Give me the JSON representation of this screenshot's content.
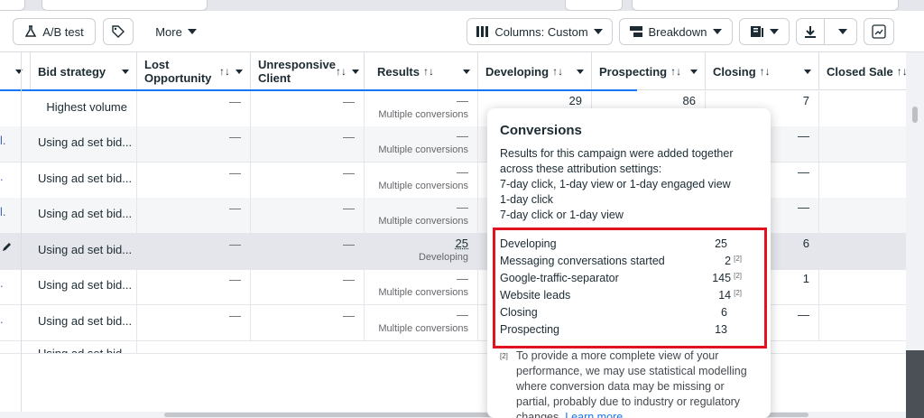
{
  "toolbar": {
    "ab_test_label": "A/B test",
    "more_label": "More",
    "columns_label": "Columns: Custom",
    "breakdown_label": "Breakdown"
  },
  "columns": {
    "bid_strategy": "Bid strategy",
    "lost_opportunity": "Lost Opportunity",
    "unresponsive_client": "Unresponsive Client",
    "results": "Results",
    "developing": "Developing",
    "prospecting": "Prospecting",
    "closing": "Closing",
    "closed_sale": "Closed Sale",
    "sort_glyph": "↑↓"
  },
  "rows": [
    {
      "bid": "Highest volume",
      "lost": "—",
      "unresp": "—",
      "results": "—",
      "results_sub": "Multiple conversions",
      "developing": "29",
      "prospecting": "86",
      "closing": "7"
    },
    {
      "bid": "Using ad set bid...",
      "lost": "—",
      "unresp": "—",
      "results": "—",
      "results_sub": "Multiple conversions",
      "closing": "—"
    },
    {
      "bid": "Using ad set bid...",
      "lost": "—",
      "unresp": "—",
      "results": "—",
      "results_sub": "Multiple conversions",
      "closing": "—"
    },
    {
      "bid": "Using ad set bid...",
      "lost": "—",
      "unresp": "—",
      "results": "—",
      "results_sub": "Multiple conversions",
      "closing": "—"
    },
    {
      "bid": "Using ad set bid...",
      "lost": "—",
      "unresp": "—",
      "results": "25",
      "results_sub": "Developing",
      "closing": "6"
    },
    {
      "bid": "Using ad set bid...",
      "lost": "—",
      "unresp": "—",
      "results": "—",
      "results_sub": "Multiple conversions",
      "closing": "1"
    },
    {
      "bid": "Using ad set bid...",
      "lost": "—",
      "unresp": "—",
      "results": "—",
      "results_sub": "Multiple conversions",
      "closing": "—"
    },
    {
      "bid": "Using ad set bid..."
    }
  ],
  "popover": {
    "title": "Conversions",
    "desc_1": "Results for this campaign were added together",
    "desc_2": "across these attribution settings:",
    "desc_3": "7-day click, 1-day view or 1-day engaged view",
    "desc_4": "1-day click",
    "desc_5": "7-day click or 1-day view",
    "items": [
      {
        "label": "Developing",
        "value": "25",
        "note": ""
      },
      {
        "label": "Messaging conversations started",
        "value": "2",
        "note": "[2]"
      },
      {
        "label": "Google-traffic-separator",
        "value": "145",
        "note": "[2]"
      },
      {
        "label": "Website leads",
        "value": "14",
        "note": "[2]"
      },
      {
        "label": "Closing",
        "value": "6",
        "note": ""
      },
      {
        "label": "Prospecting",
        "value": "13",
        "note": ""
      }
    ],
    "footnote_mark": "[2]",
    "footnote": "To provide a more complete view of your performance, we may use statistical modelling where conversion data may be missing or partial, probably due to industry or regulatory changes.",
    "learn_more": "Learn more"
  },
  "icons": [
    "flask-icon",
    "tag-icon",
    "columns-icon",
    "breakdown-icon",
    "reports-icon",
    "download-icon",
    "chart-icon",
    "pencil-icon"
  ],
  "colors": {
    "accent": "#1877f2",
    "highlight_box": "#e0141e"
  }
}
